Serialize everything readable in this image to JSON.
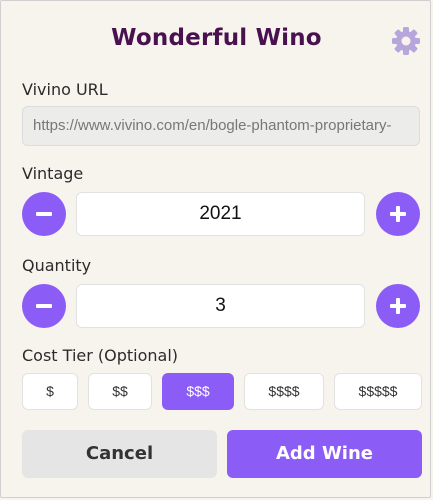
{
  "header": {
    "title": "Wonderful Wino",
    "settings_icon": "gear-icon"
  },
  "url": {
    "label": "Vivino URL",
    "value": "https://www.vivino.com/en/bogle-phantom-proprietary-"
  },
  "vintage": {
    "label": "Vintage",
    "value": "2021"
  },
  "quantity": {
    "label": "Quantity",
    "value": "3"
  },
  "cost_tier": {
    "label": "Cost Tier (Optional)",
    "options": [
      "$",
      "$$",
      "$$$",
      "$$$$",
      "$$$$$"
    ],
    "selected": "$$$"
  },
  "actions": {
    "cancel_label": "Cancel",
    "add_label": "Add Wine"
  },
  "colors": {
    "accent": "#8b5cf6",
    "title": "#4a1150",
    "background": "#f7f4ee"
  }
}
